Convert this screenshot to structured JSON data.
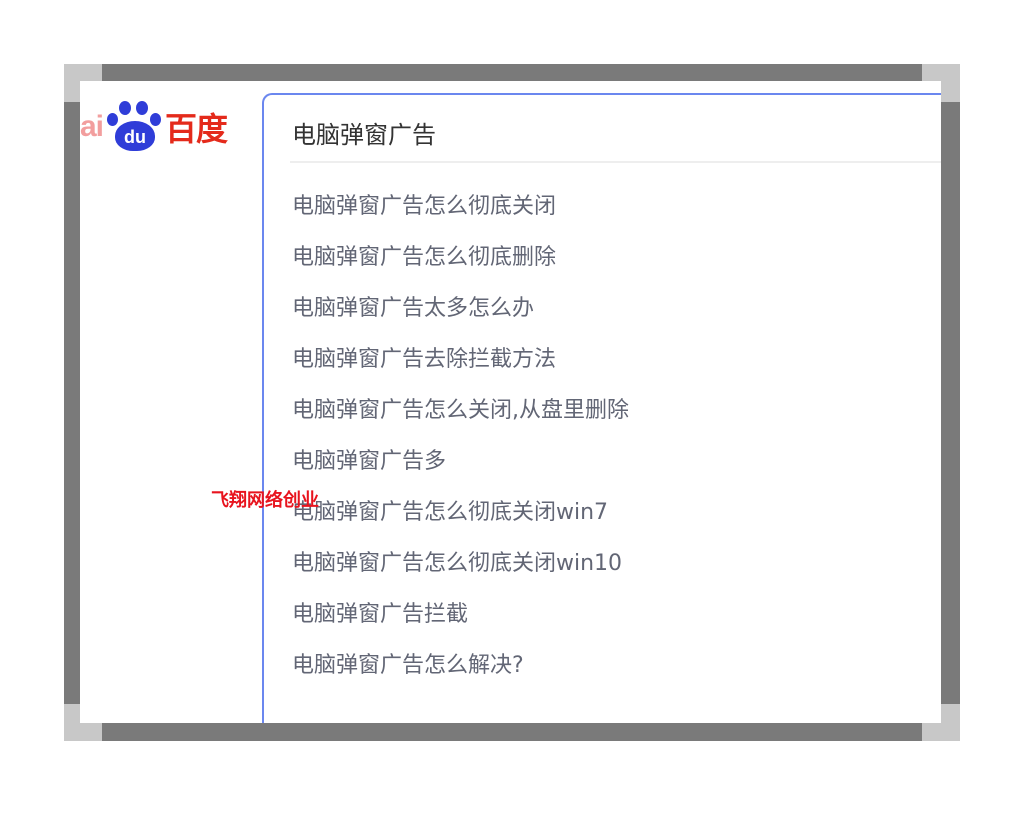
{
  "logo": {
    "prefix": "ai",
    "paw_text": "du",
    "name": "百度"
  },
  "search": {
    "query": "电脑弹窗广告",
    "suggestions": [
      "电脑弹窗广告怎么彻底关闭",
      "电脑弹窗广告怎么彻底删除",
      "电脑弹窗广告太多怎么办",
      "电脑弹窗广告去除拦截方法",
      "电脑弹窗广告怎么关闭,从盘里删除",
      "电脑弹窗广告多",
      "电脑弹窗广告怎么彻底关闭win7",
      "电脑弹窗广告怎么彻底关闭win10",
      "电脑弹窗广告拦截",
      "电脑弹窗广告怎么解决?"
    ]
  },
  "watermark": "飞翔网络创业",
  "colors": {
    "frame": "#7a7a7a",
    "frame_corner": "#c8c8c8",
    "panel_border": "#6b87ef",
    "logo_blue": "#2f3dd8",
    "logo_red": "#e42a1b",
    "watermark": "#e8141e",
    "suggestion_text": "#626675"
  }
}
